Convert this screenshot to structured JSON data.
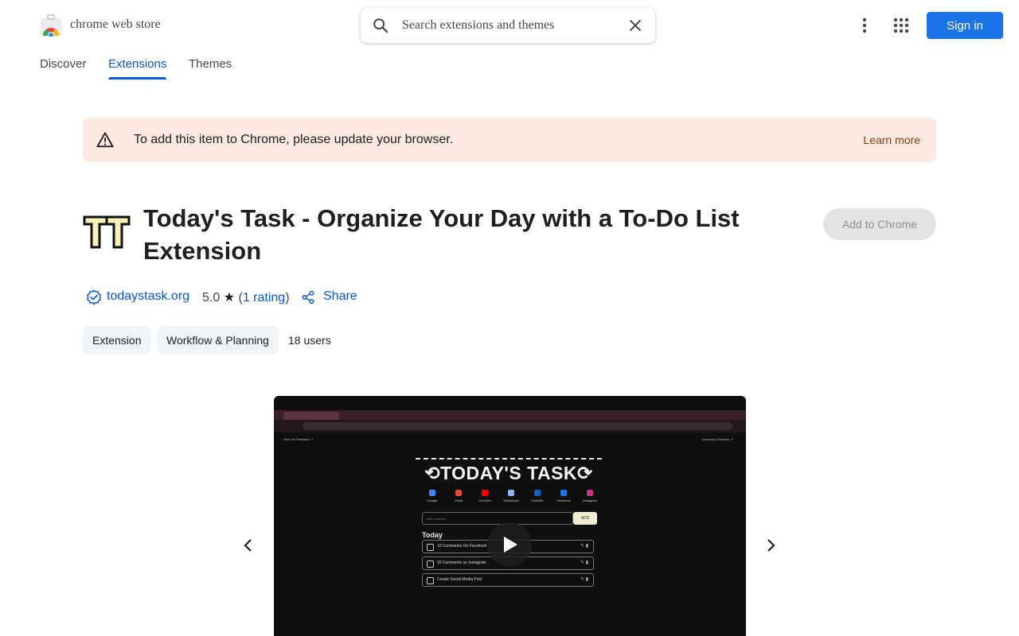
{
  "header": {
    "brand": "chrome web store",
    "search_placeholder": "Search extensions and themes",
    "sign_in": "Sign in"
  },
  "nav": {
    "tabs": [
      {
        "label": "Discover"
      },
      {
        "label": "Extensions",
        "active": true
      },
      {
        "label": "Themes"
      }
    ]
  },
  "banner": {
    "message": "To add this item to Chrome, please update your browser.",
    "link": "Learn more"
  },
  "item": {
    "title": "Today's Task - Organize Your Day with a To-Do List Extension",
    "add_button": "Add to Chrome",
    "site": "todaystask.org",
    "rating_value": "5.0",
    "rating_count": "1 rating",
    "share": "Share",
    "chips": [
      "Extension",
      "Workflow & Planning"
    ],
    "users": "18 users"
  },
  "screenshot": {
    "logo_text": "⟲TODAY'S TASK⟳",
    "left_link": "Give Us Feedback ↗",
    "right_link": "Upcoming Features ↗",
    "apps": [
      {
        "label": "Google",
        "color": "#4285f4"
      },
      {
        "label": "Gmail",
        "color": "#ea4335"
      },
      {
        "label": "YouTube",
        "color": "#ff0000"
      },
      {
        "label": "Workflowlo",
        "color": "#8ab4f8"
      },
      {
        "label": "LinkedIn",
        "color": "#0a66c2"
      },
      {
        "label": "Facebook",
        "color": "#1877f2"
      },
      {
        "label": "Instagram",
        "color": "#c13584"
      }
    ],
    "input_placeholder": "write anything...",
    "add_label": "ADD",
    "list_heading": "Today",
    "tasks": [
      "10 Comments On Facebook",
      "10 Comments on Instagram",
      "Create Social Media Post"
    ]
  },
  "colors": {
    "accent": "#0b57d0",
    "sign_in_bg": "#1a73e8",
    "banner_bg": "#fde9e1"
  }
}
